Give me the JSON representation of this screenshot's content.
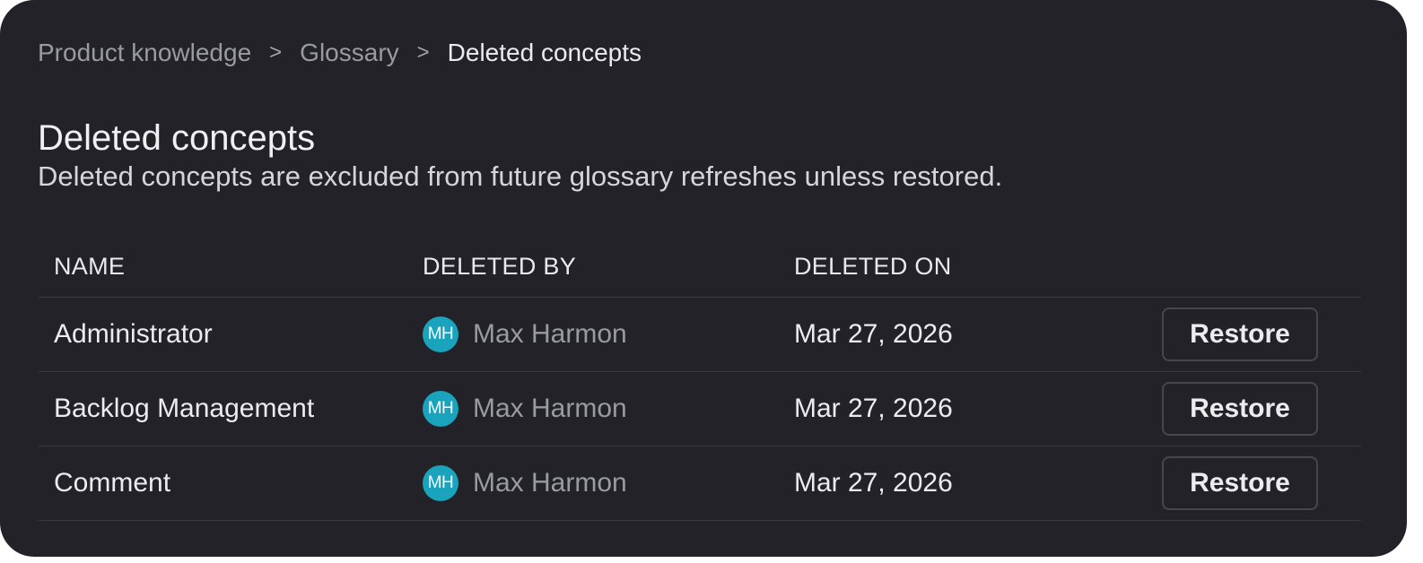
{
  "breadcrumb": {
    "items": [
      "Product knowledge",
      "Glossary",
      "Deleted concepts"
    ],
    "separator": ">"
  },
  "page": {
    "title": "Deleted concepts",
    "description": "Deleted concepts are excluded from future glossary refreshes unless restored."
  },
  "table": {
    "columns": [
      "NAME",
      "DELETED BY",
      "DELETED ON"
    ],
    "rows": [
      {
        "name": "Administrator",
        "avatar_initials": "MH",
        "deleted_by": "Max Harmon",
        "deleted_on": "Mar 27, 2026",
        "action": "Restore"
      },
      {
        "name": "Backlog Management",
        "avatar_initials": "MH",
        "deleted_by": "Max Harmon",
        "deleted_on": "Mar 27, 2026",
        "action": "Restore"
      },
      {
        "name": "Comment",
        "avatar_initials": "MH",
        "deleted_by": "Max Harmon",
        "deleted_on": "Mar 27, 2026",
        "action": "Restore"
      }
    ]
  },
  "colors": {
    "panel_background": "#222228",
    "avatar": "#1aa3bd",
    "divider": "#393940"
  }
}
